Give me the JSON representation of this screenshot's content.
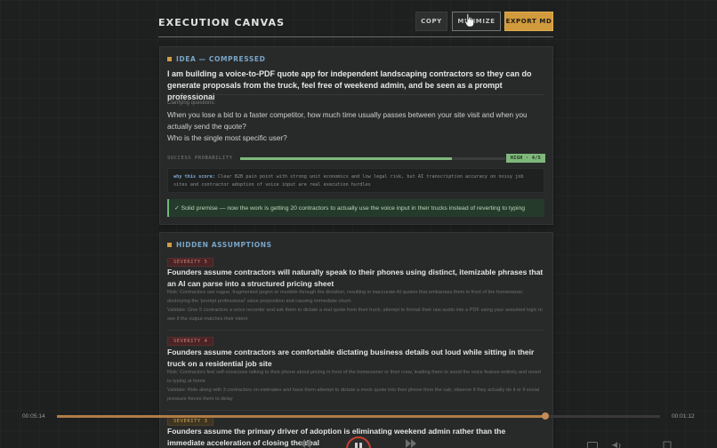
{
  "header": {
    "title": "EXECUTION CANVAS",
    "copy_label": "COPY",
    "minimize_label": "MINIMIZE",
    "export_label": "EXPORT MD"
  },
  "idea": {
    "section_label": "IDEA — COMPRESSED",
    "text": "I am building a voice-to-PDF quote app for independent landscaping contractors so they can do generate proposals from the truck, feel free of weekend admin, and be seen as a prompt professional",
    "clarifying_label": "Clarifying questions:",
    "questions": [
      "When you lose a bid to a faster competitor, how much time usually passes between your site visit and when you actually send the quote?",
      "Who is the single most specific user?"
    ]
  },
  "success": {
    "label": "SUCCESS PROBABILITY",
    "fraction": 0.8,
    "badge": "HIGH · 4/5",
    "why_label": "why this score:",
    "why_text": "Clear B2B pain point with strong unit economics and low legal risk, but AI transcription accuracy on noisy job sites and contractor adoption of voice input are real execution hurdles",
    "premise": "✓ Solid premise — now the work is getting 20 contractors to actually use the voice input in their trucks instead of reverting to typing"
  },
  "assumptions": {
    "section_label": "HIDDEN ASSUMPTIONS",
    "items": [
      {
        "severity": "SEVERITY 5",
        "title": "Founders assume contractors will naturally speak to their phones using distinct, itemizable phrases that an AI can parse into a structured pricing sheet",
        "risk": "Risk: Contractors use vague, fragmented jargon or mumble through the dictation, resulting in inaccurate AI quotes that embarrass them in front of the homeowner, destroying the 'prompt professional' value proposition and causing immediate churn",
        "validate": "Validate: Give 5 contractors a voice recorder and ask them to dictate a real quote from their truck; attempt to format their raw audio into a PDF using your assumed logic to see if the output matches their intent"
      },
      {
        "severity": "SEVERITY 4",
        "title": "Founders assume contractors are comfortable dictating business details out loud while sitting in their truck on a residential job site",
        "risk": "Risk: Contractors feel self-conscious talking to their phone about pricing in front of the homeowner or their crew, leading them to avoid the voice feature entirely and revert to typing at home",
        "validate": "Validate: Ride along with 3 contractors on estimates and have them attempt to dictate a mock quote into their phone from the cab; observe if they actually do it or if social pressure forces them to delay"
      },
      {
        "severity": "SEVERITY 3",
        "title": "Founders assume the primary driver of adoption is eliminating weekend admin rather than the immediate acceleration of closing the deal"
      }
    ]
  },
  "player": {
    "elapsed": "00:05:14",
    "total": "00:01:12",
    "progress": 0.805
  },
  "colors": {
    "accent": "#d19a3c",
    "success": "#7fb87a",
    "section": "#7aa6c8",
    "severity_high": "#d47d7d"
  }
}
